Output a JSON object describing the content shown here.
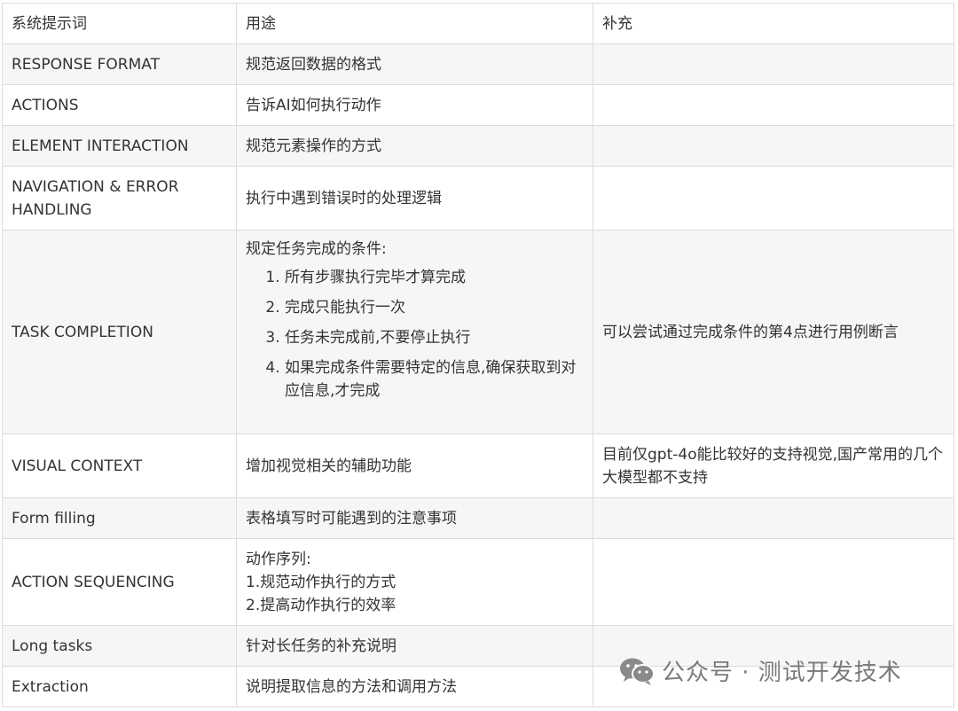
{
  "table": {
    "headers": [
      "系统提示词",
      "用途",
      "补充"
    ],
    "rows": [
      {
        "name": "RESPONSE FORMAT",
        "purpose": "规范返回数据的格式",
        "note": ""
      },
      {
        "name": "ACTIONS",
        "purpose": "告诉AI如何执行动作",
        "note": ""
      },
      {
        "name": "ELEMENT INTERACTION",
        "purpose": "规范元素操作的方式",
        "note": ""
      },
      {
        "name": "NAVIGATION & ERROR HANDLING",
        "purpose": "执行中遇到错误时的处理逻辑",
        "note": ""
      },
      {
        "name": "TASK COMPLETION",
        "purpose_intro": "规定任务完成的条件:",
        "purpose_items": [
          "所有步骤执行完毕才算完成",
          "完成只能执行一次",
          "任务未完成前,不要停止执行",
          "如果完成条件需要特定的信息,确保获取到对应信息,才完成"
        ],
        "note": "可以尝试通过完成条件的第4点进行用例断言"
      },
      {
        "name": "VISUAL CONTEXT",
        "purpose": "增加视觉相关的辅助功能",
        "note": "目前仅gpt-4o能比较好的支持视觉,国产常用的几个大模型都不支持"
      },
      {
        "name": "Form filling",
        "purpose": "表格填写时可能遇到的注意事项",
        "note": ""
      },
      {
        "name": "ACTION SEQUENCING",
        "purpose_lines": [
          "动作序列:",
          "1.规范动作执行的方式",
          "2.提高动作执行的效率"
        ],
        "note": ""
      },
      {
        "name": "Long tasks",
        "purpose": "针对长任务的补充说明",
        "note": ""
      },
      {
        "name": "Extraction",
        "purpose": "说明提取信息的方法和调用方法",
        "note": ""
      }
    ]
  },
  "watermark": {
    "text": "公众号 · 测试开发技术",
    "icon": "wechat-icon"
  }
}
